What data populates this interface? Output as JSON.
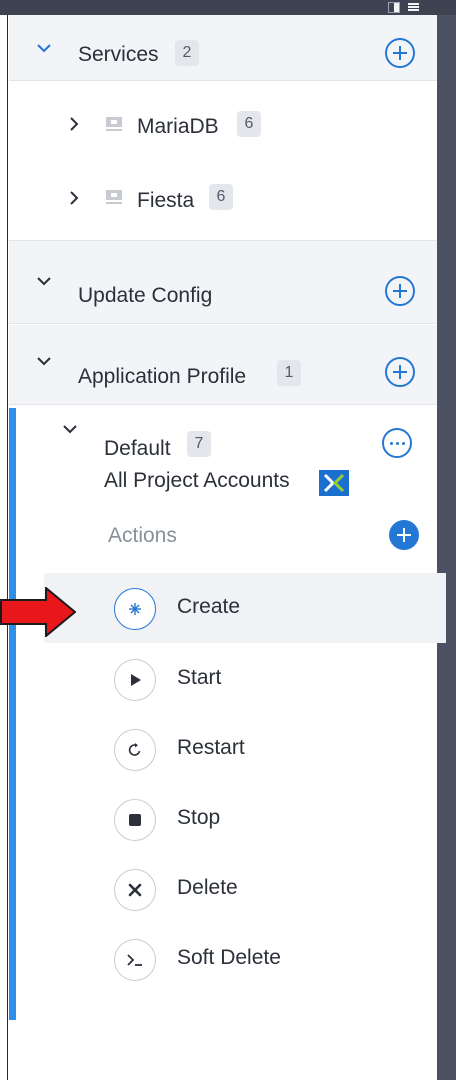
{
  "sidebar": {
    "services": {
      "label": "Services",
      "count": "2"
    },
    "service_items": [
      {
        "label": "MariaDB",
        "count": "6"
      },
      {
        "label": "Fiesta",
        "count": "6"
      }
    ],
    "update_config": {
      "label": "Update Config"
    },
    "application_profile": {
      "label": "Application Profile",
      "count": "1"
    },
    "profile": {
      "label": "Default",
      "count": "7",
      "accounts_label": "All Project Accounts",
      "actions_label": "Actions"
    },
    "actions": [
      {
        "label": "Create",
        "icon": "sparkle-icon",
        "active": true
      },
      {
        "label": "Start",
        "icon": "play-icon"
      },
      {
        "label": "Restart",
        "icon": "restart-icon"
      },
      {
        "label": "Stop",
        "icon": "stop-icon"
      },
      {
        "label": "Delete",
        "icon": "delete-x-icon"
      },
      {
        "label": "Soft Delete",
        "icon": "terminal-icon"
      }
    ]
  },
  "colors": {
    "accent": "#2478d5",
    "section_bg": "#f3f4f7",
    "active_bar": "#2f8fe8",
    "arrow": "#e8171c"
  }
}
